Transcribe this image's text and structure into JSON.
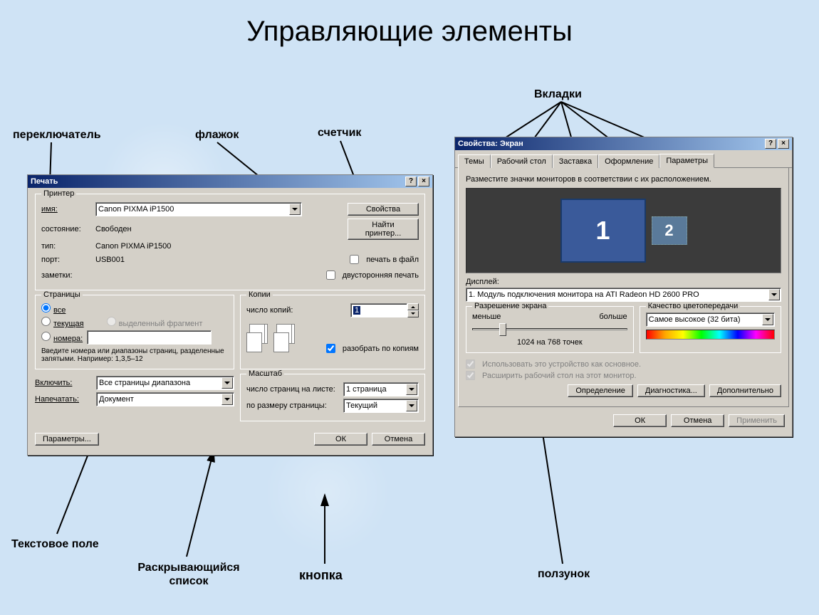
{
  "title": "Управляющие элементы",
  "annotations": {
    "switch": "переключатель",
    "flag": "флажок",
    "spinner": "счетчик",
    "tabs": "Вкладки",
    "textfield": "Текстовое поле",
    "dropdown": "Раскрывающийся список",
    "button": "кнопка",
    "slider": "ползунок"
  },
  "print": {
    "title": "Печать",
    "printer_group": "Принтер",
    "name_label": "имя:",
    "name_value": "Canon PIXMA iP1500",
    "status_label": "состояние:",
    "status_value": "Свободен",
    "type_label": "тип:",
    "type_value": "Canon PIXMA iP1500",
    "port_label": "порт:",
    "port_value": "USB001",
    "notes_label": "заметки:",
    "btn_props": "Свойства",
    "btn_find": "Найти принтер...",
    "cb_tofile": "печать в файл",
    "cb_duplex": "двусторонняя печать",
    "pages_group": "Страницы",
    "radio_all": "все",
    "radio_current": "текущая",
    "radio_selection": "выделенный фрагмент",
    "radio_numbers": "номера:",
    "pages_hint": "Введите номера или диапазоны страниц, разделенные запятыми. Например: 1,3,5–12",
    "include_label": "Включить:",
    "include_value": "Все страницы диапазона",
    "printwhat_label": "Напечатать:",
    "printwhat_value": "Документ",
    "copies_group": "Копии",
    "copies_label": "число копий:",
    "copies_value": "1",
    "collate": "разобрать по копиям",
    "scale_group": "Масштаб",
    "ppp_label": "число страниц на листе:",
    "ppp_value": "1 страница",
    "fit_label": "по размеру страницы:",
    "fit_value": "Текущий",
    "btn_params": "Параметры...",
    "btn_ok": "ОК",
    "btn_cancel": "Отмена"
  },
  "display": {
    "title": "Свойства: Экран",
    "tabs": [
      "Темы",
      "Рабочий стол",
      "Заставка",
      "Оформление"
    ],
    "tab_active": "Параметры",
    "hint": "Разместите значки мониторов в соответствии с их расположением.",
    "mon1": "1",
    "mon2": "2",
    "display_label": "Дисплей:",
    "display_value": "1. Модуль подключения монитора на ATI Radeon HD 2600 PRO",
    "res_group": "Разрешение экрана",
    "res_less": "меньше",
    "res_more": "больше",
    "res_value": "1024 на 768 точек",
    "color_group": "Качество цветопередачи",
    "color_value": "Самое высокое (32 бита)",
    "cb_primary": "Использовать это устройство как основное.",
    "cb_extend": "Расширить рабочий стол на этот монитор.",
    "btn_identify": "Определение",
    "btn_diag": "Диагностика...",
    "btn_adv": "Дополнительно",
    "btn_ok": "ОК",
    "btn_cancel": "Отмена",
    "btn_apply": "Применить"
  }
}
